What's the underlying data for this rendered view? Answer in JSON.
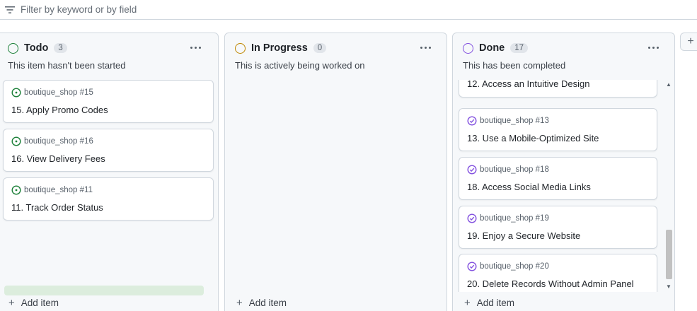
{
  "filter": {
    "icon": "filter-lines-icon",
    "placeholder": "Filter by keyword or by field"
  },
  "colors": {
    "todo_status": "#1a7f37",
    "in_progress_status": "#bf8700",
    "done_status": "#8250df",
    "border": "#d0d7de",
    "column_bg": "#f6f8fa"
  },
  "columns": [
    {
      "name": "Todo",
      "count": "3",
      "description": "This item hasn't been started",
      "add_label": "Add item",
      "cards": [
        {
          "repo": "boutique_shop #15",
          "title": "15. Apply Promo Codes"
        },
        {
          "repo": "boutique_shop #16",
          "title": "16. View Delivery Fees"
        },
        {
          "repo": "boutique_shop #11",
          "title": "11. Track Order Status"
        }
      ]
    },
    {
      "name": "In Progress",
      "count": "0",
      "description": "This is actively being worked on",
      "add_label": "Add item",
      "cards": []
    },
    {
      "name": "Done",
      "count": "17",
      "description": "This has been completed",
      "add_label": "Add item",
      "cards": [
        {
          "repo": "",
          "title": "12. Access an Intuitive Design"
        },
        {
          "repo": "boutique_shop #13",
          "title": "13. Use a Mobile-Optimized Site"
        },
        {
          "repo": "boutique_shop #18",
          "title": "18. Access Social Media Links"
        },
        {
          "repo": "boutique_shop #19",
          "title": "19. Enjoy a Secure Website"
        },
        {
          "repo": "boutique_shop #20",
          "title": "20. Delete Records Without Admin Panel"
        }
      ]
    }
  ],
  "new_column_button": "+"
}
